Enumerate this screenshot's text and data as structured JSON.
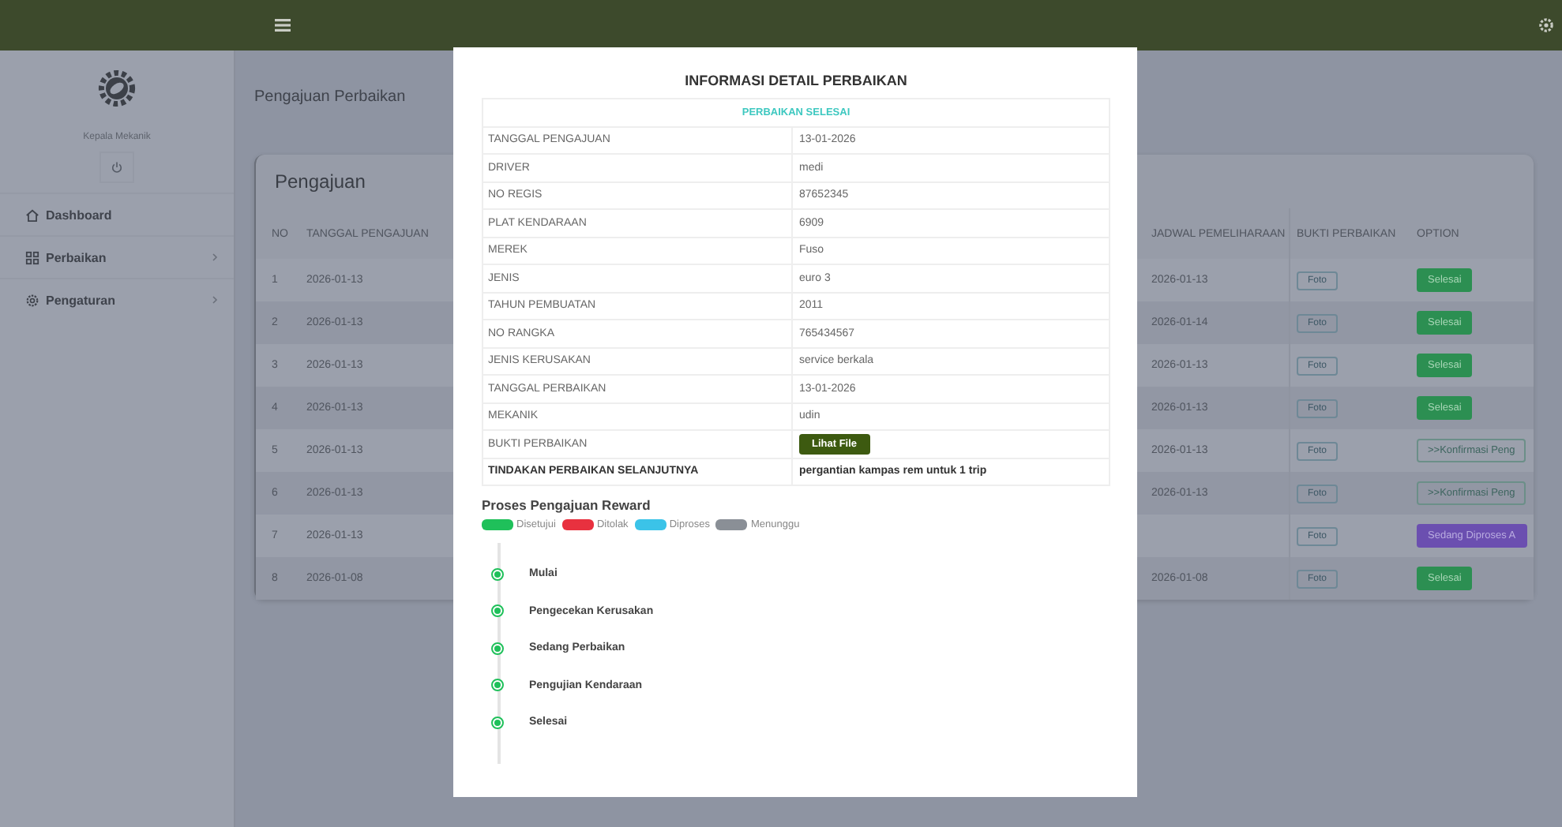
{
  "sidebar": {
    "role": "Kepala Mekanik",
    "items": [
      {
        "label": "Dashboard",
        "has_children": false
      },
      {
        "label": "Perbaikan",
        "has_children": true
      },
      {
        "label": "Pengaturan",
        "has_children": true
      }
    ]
  },
  "breadcrumb": "Pengajuan Perbaikan",
  "card": {
    "title": "Pengajuan",
    "columns_left": [
      "NO",
      "TANGGAL PENGAJUAN"
    ],
    "columns_right": [
      "JADWAL PEMELIHARAAN",
      "BUKTI PERBAIKAN",
      "OPTION"
    ],
    "rows": [
      {
        "no": "1",
        "tanggal": "2026-01-13",
        "jadwal": "2026-01-13",
        "bukti": "Foto",
        "option": {
          "kind": "done",
          "label": "Selesai"
        }
      },
      {
        "no": "2",
        "tanggal": "2026-01-13",
        "jadwal": "2026-01-14",
        "bukti": "Foto",
        "option": {
          "kind": "done",
          "label": "Selesai"
        }
      },
      {
        "no": "3",
        "tanggal": "2026-01-13",
        "jadwal": "2026-01-13",
        "bukti": "Foto",
        "option": {
          "kind": "done",
          "label": "Selesai"
        }
      },
      {
        "no": "4",
        "tanggal": "2026-01-13",
        "jadwal": "2026-01-13",
        "bukti": "Foto",
        "option": {
          "kind": "done",
          "label": "Selesai"
        }
      },
      {
        "no": "5",
        "tanggal": "2026-01-13",
        "jadwal": "2026-01-13",
        "bukti": "Foto",
        "option": {
          "kind": "confirm",
          "label": ">>Konfirmasi Peng"
        }
      },
      {
        "no": "6",
        "tanggal": "2026-01-13",
        "jadwal": "2026-01-13",
        "bukti": "Foto",
        "option": {
          "kind": "confirm",
          "label": ">>Konfirmasi Peng"
        }
      },
      {
        "no": "7",
        "tanggal": "2026-01-13",
        "bukti": "Foto",
        "option": {
          "kind": "processing",
          "label": "Sedang Diproses A"
        }
      },
      {
        "no": "8",
        "tanggal": "2026-01-08",
        "jadwal": "2026-01-08",
        "bukti": "Foto",
        "option": {
          "kind": "done",
          "label": "Selesai"
        }
      }
    ]
  },
  "modal": {
    "title": "INFORMASI DETAIL PERBAIKAN",
    "status": "PERBAIKAN SELESAI",
    "details": [
      {
        "label": "TANGGAL PENGAJUAN",
        "value": "13-01-2026",
        "kind": "text"
      },
      {
        "label": "DRIVER",
        "value": "medi",
        "kind": "text"
      },
      {
        "label": "NO REGIS",
        "value": "87652345",
        "kind": "text"
      },
      {
        "label": "PLAT KENDARAAN",
        "value": "6909",
        "kind": "text"
      },
      {
        "label": "MEREK",
        "value": "Fuso",
        "kind": "text"
      },
      {
        "label": "JENIS",
        "value": "euro 3",
        "kind": "text"
      },
      {
        "label": "TAHUN PEMBUATAN",
        "value": "2011",
        "kind": "text"
      },
      {
        "label": "NO RANGKA",
        "value": "765434567",
        "kind": "text"
      },
      {
        "label": "JENIS KERUSAKAN",
        "value": "service berkala",
        "kind": "text"
      },
      {
        "label": "TANGGAL PERBAIKAN",
        "value": "13-01-2026",
        "kind": "text"
      },
      {
        "label": "MEKANIK",
        "value": "udin",
        "kind": "text"
      },
      {
        "label": "BUKTI PERBAIKAN",
        "value": "Lihat File",
        "kind": "button"
      },
      {
        "label": "TINDAKAN PERBAIKAN SELANJUTNYA",
        "value": "pergantian kampas rem untuk 1 trip",
        "kind": "emphasis"
      }
    ],
    "process_title": "Proses Pengajuan Reward",
    "legend": [
      {
        "label": "Disetujui",
        "color": "#1fc05a"
      },
      {
        "label": "Ditolak",
        "color": "#e8313f"
      },
      {
        "label": "Diproses",
        "color": "#3bc3e8"
      },
      {
        "label": "Menunggu",
        "color": "#8a8f96"
      }
    ],
    "steps": [
      {
        "label": "Mulai",
        "color": "#1fc05a"
      },
      {
        "label": "Pengecekan Kerusakan",
        "color": "#1fc05a"
      },
      {
        "label": "Sedang Perbaikan",
        "color": "#1fc05a"
      },
      {
        "label": "Pengujian Kendaraan",
        "color": "#1fc05a"
      },
      {
        "label": "Selesai",
        "color": "#1fc05a"
      }
    ]
  }
}
